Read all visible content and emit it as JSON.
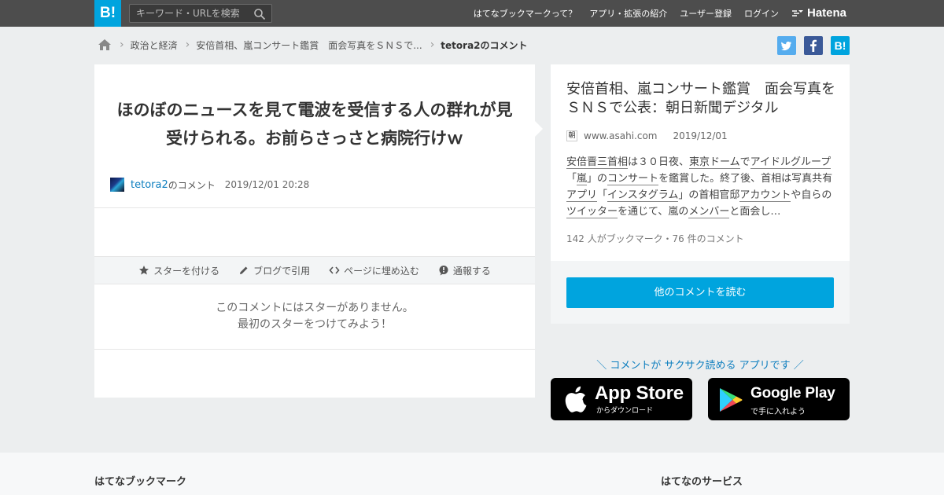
{
  "header": {
    "logo": "B!",
    "search_placeholder": "キーワード・URLを検索",
    "nav": [
      "はてなブックマークって？",
      "アプリ・拡張の紹介",
      "ユーザー登録",
      "ログイン"
    ],
    "brand": "Hatena"
  },
  "breadcrumb": {
    "items": [
      "政治と経済",
      "安倍首相、嵐コンサート鑑賞　面会写真をＳＮＳで..."
    ],
    "current": "tetora2のコメント"
  },
  "share": {
    "colors": {
      "twitter": "#55acee",
      "facebook": "#3b5998",
      "hatena": "#00a4de"
    },
    "hatena_label": "B!"
  },
  "comment": {
    "text": "ほのぼのニュースを見て電波を受信する人の群れが見受けられる。お前らさっさと病院行けｗ",
    "user": "tetora2",
    "user_suffix": "のコメント",
    "date": "2019/12/01 20:28",
    "actions": [
      "スターを付ける",
      "ブログで引用",
      "ページに埋め込む",
      "通報する"
    ],
    "no_stars_line1": "このコメントにはスターがありません。",
    "no_stars_line2": "最初のスターをつけてみよう！"
  },
  "entry": {
    "title": "安倍首相、嵐コンサート鑑賞　面会写真をＳＮＳで公表：朝日新聞デジタル",
    "favicon": "朝",
    "site": "www.asahi.com",
    "date": "2019/12/01",
    "summary": [
      {
        "t": "安倍晋三首相",
        "k": true
      },
      {
        "t": "は３０日夜、",
        "k": false
      },
      {
        "t": "東京ドーム",
        "k": true
      },
      {
        "t": "で",
        "k": false
      },
      {
        "t": "アイドルグループ",
        "k": true
      },
      {
        "t": "「",
        "k": false
      },
      {
        "t": "嵐",
        "k": true
      },
      {
        "t": "」の",
        "k": false
      },
      {
        "t": "コンサート",
        "k": true
      },
      {
        "t": "を鑑賞した。終了後、首相は写真共有",
        "k": false
      },
      {
        "t": "アプリ",
        "k": true
      },
      {
        "t": "「",
        "k": false
      },
      {
        "t": "インスタグラム",
        "k": true
      },
      {
        "t": "」の首相官邸",
        "k": false
      },
      {
        "t": "アカウント",
        "k": true
      },
      {
        "t": "や自らの",
        "k": false
      },
      {
        "t": "ツイッター",
        "k": true
      },
      {
        "t": "を通じて、嵐の",
        "k": false
      },
      {
        "t": "メンバー",
        "k": true
      },
      {
        "t": "と面会し…",
        "k": false
      }
    ],
    "counts": "142 人がブックマーク・76 件のコメント",
    "read_more": "他のコメントを読む"
  },
  "app_promo": {
    "text": "＼ コメントが サクサク読める アプリです ／",
    "app_store_big": "App Store",
    "app_store_small": "からダウンロード",
    "google_play_big": "Google Play",
    "google_play_small": "で手に入れよう"
  },
  "footer": {
    "left_title": "はてなブックマーク",
    "right_title": "はてなのサービス"
  }
}
